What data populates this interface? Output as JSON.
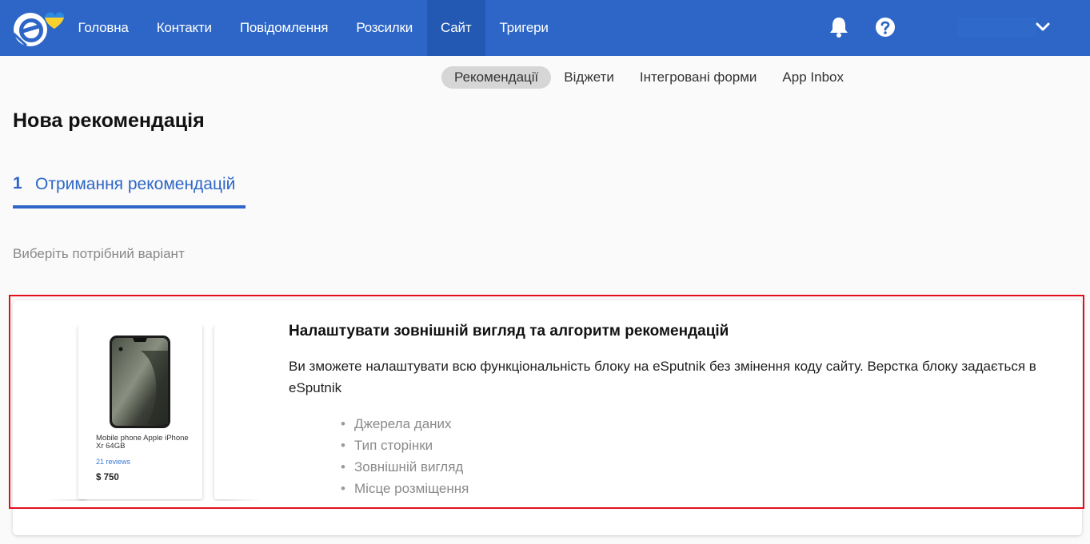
{
  "header": {
    "nav": [
      {
        "label": "Головна"
      },
      {
        "label": "Контакти"
      },
      {
        "label": "Повідомлення"
      },
      {
        "label": "Розсилки"
      },
      {
        "label": "Сайт",
        "active": true
      },
      {
        "label": "Тригери"
      }
    ],
    "icons": [
      "esputnik-logo",
      "bell-icon",
      "help-icon",
      "chevron-down-icon"
    ],
    "brand_color": "#2d66c7"
  },
  "subnav": [
    {
      "label": "Рекомендації",
      "active": true
    },
    {
      "label": "Віджети"
    },
    {
      "label": "Інтегровані форми"
    },
    {
      "label": "App Inbox"
    }
  ],
  "page": {
    "title": "Нова рекомендація",
    "step_number": "1",
    "step_label": "Отримання рекомендацій",
    "hint": "Виберіть потрібний варіант"
  },
  "option": {
    "title": "Налаштувати зовнішній вигляд та алгоритм рекомендацій",
    "description": "Ви зможете налаштувати всю функціональність блоку на eSputnik без змінення коду сайту. Верстка блоку задається в eSputnik",
    "features": [
      "Джерела даних",
      "Тип сторінки",
      "Зовнішній вигляд",
      "Місце розміщення"
    ],
    "highlight_color": "#e3101c",
    "preview_product": {
      "name": "Mobile phone Apple iPhone Xr 64GB",
      "reviews": "21 reviews",
      "price": "$ 750"
    }
  }
}
